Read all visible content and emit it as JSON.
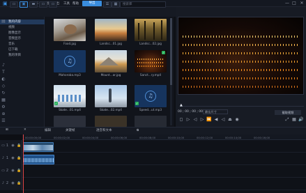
{
  "titlebar": {
    "logo": "▣",
    "menu": [
      "文件",
      "编辑",
      "操作",
      "视图",
      "导出",
      "工具",
      "帮助"
    ],
    "badge": "导出",
    "title": "未命名的新项目",
    "controls": [
      "—",
      "□",
      "✕"
    ]
  },
  "media_toolbar": {
    "buttons": [
      "▭",
      "▣",
      "▬",
      "▭",
      "▭"
    ],
    "search_placeholder": "搜索库"
  },
  "sidebar": {
    "items": [
      {
        "label": "我的内容",
        "active": true
      },
      {
        "label": "视频"
      },
      {
        "label": "图像显示"
      },
      {
        "label": "音频显示"
      },
      {
        "label": "音乐"
      },
      {
        "label": "已下载"
      },
      {
        "label": "我的项目"
      }
    ],
    "icons": [
      "▤",
      "♪",
      "T",
      "◐",
      "◇",
      "↻",
      "▦",
      "⚙",
      "⊕",
      "☰"
    ]
  },
  "media": {
    "tiles": [
      {
        "label": "Food.jpg",
        "kind": "food",
        "checked": false
      },
      {
        "label": "Landsc...01.jpg",
        "kind": "sunset",
        "checked": false
      },
      {
        "label": "Landsc...02.jpg",
        "kind": "forest",
        "checked": false
      },
      {
        "label": "Mahoroba.mp3",
        "kind": "audio",
        "checked": false
      },
      {
        "label": "Mount...ar.jpg",
        "kind": "mountain",
        "checked": false
      },
      {
        "label": "Sanct...ry.mp4",
        "kind": "candles",
        "checked": true
      },
      {
        "label": "Skate...01.mp4",
        "kind": "skate1",
        "checked": true
      },
      {
        "label": "Skate...02.mp4",
        "kind": "skate2",
        "checked": false
      },
      {
        "label": "Speed...ut.mp3",
        "kind": "audio",
        "checked": true
      },
      {
        "label": "",
        "kind": "dark1",
        "checked": false
      },
      {
        "label": "",
        "kind": "dark2",
        "checked": false
      },
      {
        "label": "",
        "kind": "dark3",
        "checked": false
      }
    ]
  },
  "preview": {
    "timecode": "00 ; 00 ; 00 ; 00",
    "ratio": "最佳尺寸",
    "snapshot": "截取视频",
    "playhead_glyph": "▲",
    "controls": [
      "◻",
      "▷",
      "◁",
      "▷",
      "⏩",
      "◀",
      "◁",
      "⏏",
      "◉",
      "⤢",
      "▦",
      "🔊"
    ]
  },
  "timeline": {
    "tool_icons": [
      "⊞",
      "✕"
    ],
    "tools": [
      "编辑",
      "关键帧",
      "透音和文本"
    ],
    "ruler": [
      "00:00:00;00",
      "00:00:02;00",
      "00:00:04;00",
      "00:00:06;00",
      "00:00:08;00",
      "00:00:10;00",
      "00:00:12;00",
      "00:00:14;00",
      "00:00:16;00"
    ],
    "tracks": [
      {
        "num": "1",
        "icons": [
          "▭",
          "◉",
          "🔒"
        ]
      },
      {
        "num": "1",
        "icons": [
          "♪",
          "◉",
          "🔒"
        ]
      },
      {
        "num": "2",
        "icons": [
          "▭",
          "◉",
          "🔒"
        ]
      },
      {
        "num": "2",
        "icons": [
          "♪",
          "◉",
          "🔒"
        ]
      }
    ]
  },
  "colors": {
    "accent": "#3a8dde",
    "check": "#27b05a",
    "playhead": "#e04646"
  }
}
